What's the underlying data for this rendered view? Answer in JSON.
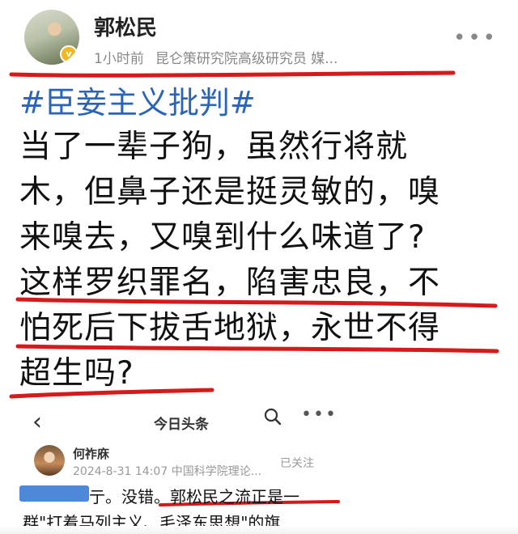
{
  "post": {
    "author": "郭松民",
    "time": "1小时前",
    "bio": "昆仑策研究院高级研究员 媒...",
    "more": "•••",
    "hashtag": "#臣妾主义批判#",
    "lines": [
      "当了一辈子狗，虽然行将就",
      "木，但鼻子还是挺灵敏的，嗅",
      "来嗅去，又嗅到什么味道了?",
      "这样罗织罪名，陷害忠良，不",
      "怕死后下拔舌地狱，永世不得",
      "超生吗?"
    ]
  },
  "second_screen": {
    "nav": {
      "back_icon": "‹",
      "title": "今日头条",
      "more": "•••"
    },
    "author": "何祚庥",
    "meta": "2024-8-31 14:07  中国科学院理论...",
    "follow_status": "已关注",
    "lines": [
      "亍。没错。郭松民之流正是一",
      "群\"打着马列主义、毛泽东思想\"的旗"
    ]
  },
  "colors": {
    "hashtag": "#2a64b8",
    "underline": "#d41a1a",
    "meta": "#888888"
  },
  "icons": [
    "verified-badge-icon",
    "more-dots-icon",
    "back-icon",
    "search-icon"
  ]
}
